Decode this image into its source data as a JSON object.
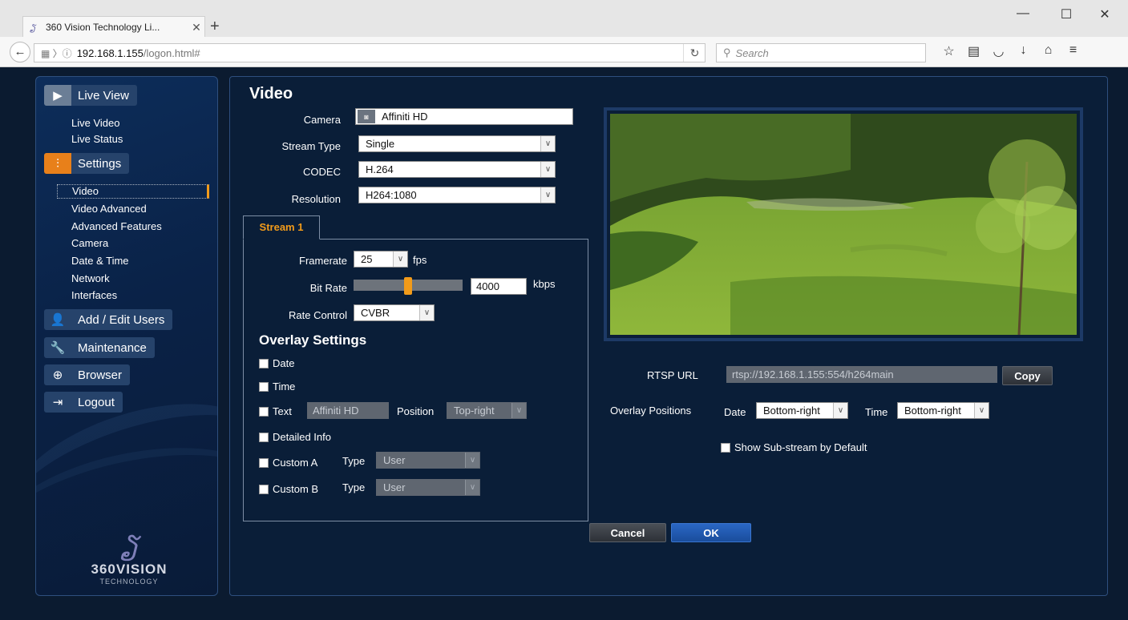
{
  "browser": {
    "tab_title": "360 Vision Technology Li...",
    "url_host": "192.168.1.155",
    "url_path": "/logon.html#",
    "search_placeholder": "Search"
  },
  "sidebar": {
    "live_view": "Live View",
    "live_video": "Live Video",
    "live_status": "Live Status",
    "settings": "Settings",
    "settings_items": [
      "Video",
      "Video Advanced",
      "Advanced Features",
      "Camera",
      "Date & Time",
      "Network",
      "Interfaces"
    ],
    "active_item": "Video",
    "add_edit_users": "Add / Edit Users",
    "maintenance": "Maintenance",
    "browser": "Browser",
    "logout": "Logout",
    "logo_name": "360VISION",
    "logo_sub": "TECHNOLOGY"
  },
  "video": {
    "title": "Video",
    "camera_label": "Camera",
    "camera_value": "Affiniti HD",
    "stream_type_label": "Stream Type",
    "stream_type_value": "Single",
    "codec_label": "CODEC",
    "codec_value": "H.264",
    "resolution_label": "Resolution",
    "resolution_value": "H264:1080",
    "tab_label": "Stream 1",
    "framerate_label": "Framerate",
    "framerate_value": "25",
    "framerate_unit": "fps",
    "bitrate_label": "Bit Rate",
    "bitrate_value": "4000",
    "bitrate_unit": "kbps",
    "bitrate_slider_fraction": 0.5,
    "rate_control_label": "Rate Control",
    "rate_control_value": "CVBR",
    "overlay_title": "Overlay Settings",
    "overlay": {
      "date": "Date",
      "time": "Time",
      "text": "Text",
      "text_value": "Affiniti HD",
      "position_label": "Position",
      "position_value": "Top-right",
      "detailed_info": "Detailed Info",
      "custom_a": "Custom A",
      "custom_b": "Custom B",
      "type_label": "Type",
      "type_value": "User"
    }
  },
  "right": {
    "rtsp_label": "RTSP URL",
    "rtsp_value": "rtsp://192.168.1.155:554/h264main",
    "copy": "Copy",
    "overlay_positions_label": "Overlay Positions",
    "date_label": "Date",
    "date_value": "Bottom-right",
    "time_label": "Time",
    "time_value": "Bottom-right",
    "substream": "Show Sub-stream by Default"
  },
  "buttons": {
    "cancel": "Cancel",
    "ok": "OK"
  }
}
